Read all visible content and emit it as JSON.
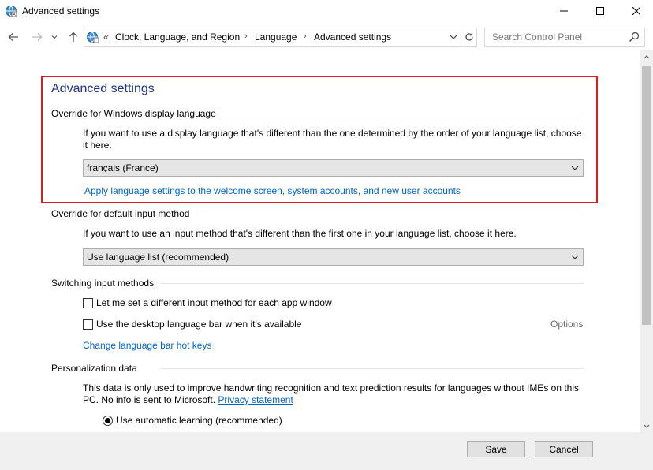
{
  "window": {
    "title": "Advanced settings"
  },
  "address": {
    "overflow": "«",
    "crumbs": [
      "Clock, Language, and Region",
      "Language",
      "Advanced settings"
    ],
    "separator": "›",
    "search_placeholder": "Search Control Panel"
  },
  "main": {
    "page_title": "Advanced settings",
    "display_language": {
      "heading": "Override for Windows display language",
      "description": "If you want to use a display language that's different than the one determined by the order of your language list, choose it here.",
      "selected": "français (France)",
      "apply_link": "Apply language settings to the welcome screen, system accounts, and new user accounts"
    },
    "input_method": {
      "heading": "Override for default input method",
      "description": "If you want to use an input method that's different than the first one in your language list, choose it here.",
      "selected": "Use language list (recommended)"
    },
    "switching": {
      "heading": "Switching input methods",
      "checkbox1": "Let me set a different input method for each app window",
      "checkbox2": "Use the desktop language bar when it's available",
      "options_link": "Options",
      "hotkeys_link": "Change language bar hot keys"
    },
    "personalization": {
      "heading": "Personalization data",
      "description": "This data is only used to improve handwriting recognition and text prediction results for languages without IMEs on this PC. No info is sent to Microsoft.",
      "privacy_link": "Privacy statement",
      "radio1": "Use automatic learning (recommended)"
    }
  },
  "footer": {
    "save_label": "Save",
    "cancel_label": "Cancel"
  },
  "colors": {
    "highlight_border": "#e01b24",
    "link": "#0066cc",
    "title": "#1e3287"
  }
}
